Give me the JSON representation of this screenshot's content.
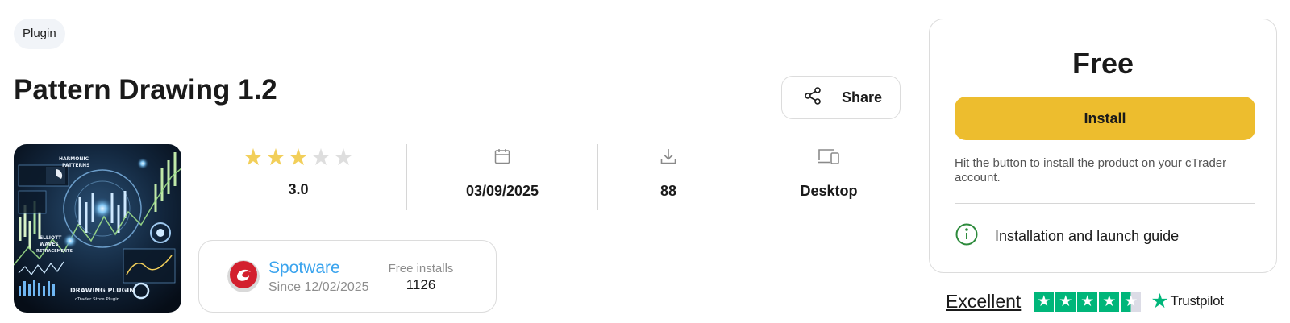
{
  "product": {
    "type_badge": "Plugin",
    "title": "Pattern Drawing 1.2",
    "thumbnail_alt": "Drawing Plugin cTrader Store Plugin artwork",
    "thumbnail_texts": [
      "HARMONIC",
      "PATTERNS",
      "ELLIOTT",
      "WAVES",
      "RETRACEMENTS",
      "DRAWING PLUGIN",
      "cTrader Store Plugin"
    ]
  },
  "share": {
    "label": "Share",
    "icon": "share-icon"
  },
  "stats": {
    "rating": {
      "value": "3.0",
      "stars": 3,
      "max_stars": 5
    },
    "date": {
      "icon": "calendar-icon",
      "value": "03/09/2025"
    },
    "downloads": {
      "icon": "download-icon",
      "value": "88"
    },
    "platform": {
      "icon": "devices-icon",
      "value": "Desktop"
    }
  },
  "publisher": {
    "name": "Spotware",
    "since": "Since 12/02/2025",
    "installs_label": "Free installs",
    "installs": "1126"
  },
  "purchase": {
    "price": "Free",
    "button": "Install",
    "hint": "Hit the button to install the product on your cTrader account.",
    "guide": "Installation and launch guide",
    "colors": {
      "button": "#edbd2e",
      "guide_icon": "#2e8b3d"
    }
  },
  "trustpilot": {
    "rating_word": "Excellent",
    "brand": "Trustpilot",
    "stars": 4.5,
    "color": "#00b67a"
  }
}
